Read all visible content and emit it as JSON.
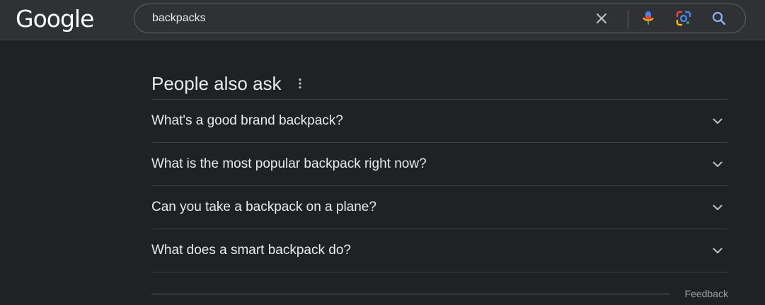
{
  "header": {
    "logo_text": "Google",
    "search": {
      "value": "backpacks",
      "placeholder": ""
    },
    "icons": {
      "clear": "close-icon",
      "voice": "microphone-icon",
      "lens": "lens-icon",
      "search": "search-icon"
    }
  },
  "people_also_ask": {
    "title": "People also ask",
    "questions": [
      "What's a good brand backpack?",
      "What is the most popular backpack right now?",
      "Can you take a backpack on a plane?",
      "What does a smart backpack do?"
    ],
    "feedback_label": "Feedback"
  },
  "colors": {
    "background": "#202124",
    "header_background": "#303134",
    "text": "#e8eaed",
    "muted_text": "#9aa0a6",
    "divider": "#3c4043",
    "search_icon_blue": "#8ab4f8"
  }
}
